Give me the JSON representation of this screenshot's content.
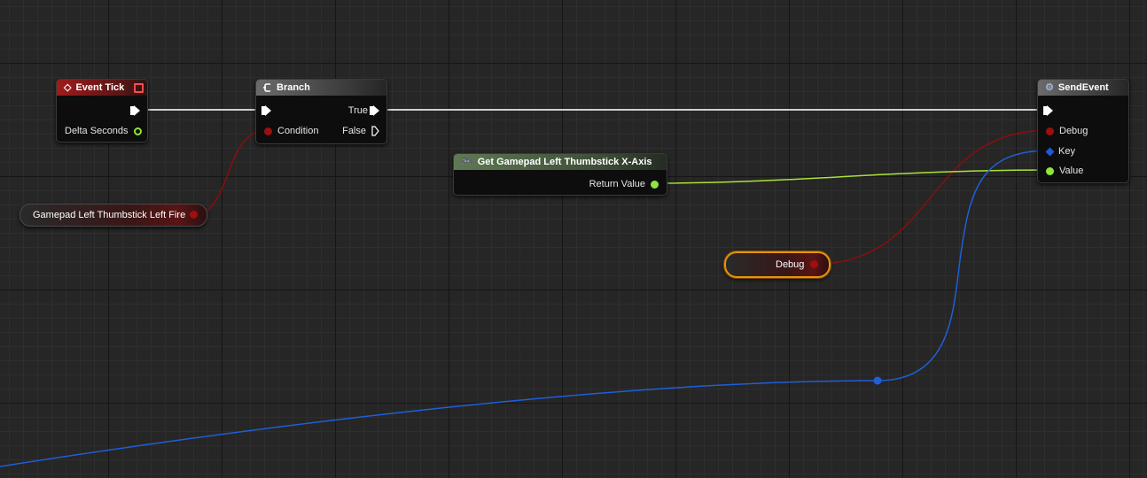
{
  "nodes": {
    "event_tick": {
      "title": "Event Tick",
      "delta_seconds": "Delta Seconds"
    },
    "branch": {
      "title": "Branch",
      "condition": "Condition",
      "true_label": "True",
      "false_label": "False"
    },
    "get_gamepad": {
      "title": "Get Gamepad Left Thumbstick X-Axis",
      "return_value": "Return Value"
    },
    "send_event": {
      "title": "SendEvent",
      "debug": "Debug",
      "key": "Key",
      "value": "Value"
    },
    "gamepad_var": {
      "label": "Gamepad Left Thumbstick Left Fire"
    },
    "debug_var": {
      "label": "Debug"
    }
  },
  "colors": {
    "exec_wire": "#cfcfcf",
    "bool_wire": "#8a0e0e",
    "float_wire": "#a8e13a",
    "key_wire": "#1f5fd8",
    "selection": "#e8920e"
  },
  "icons": {
    "event_tick": "event-diamond-icon",
    "branch": "branch-icon",
    "get_gamepad": "gamepad-icon",
    "send_event": "gear-icon"
  }
}
